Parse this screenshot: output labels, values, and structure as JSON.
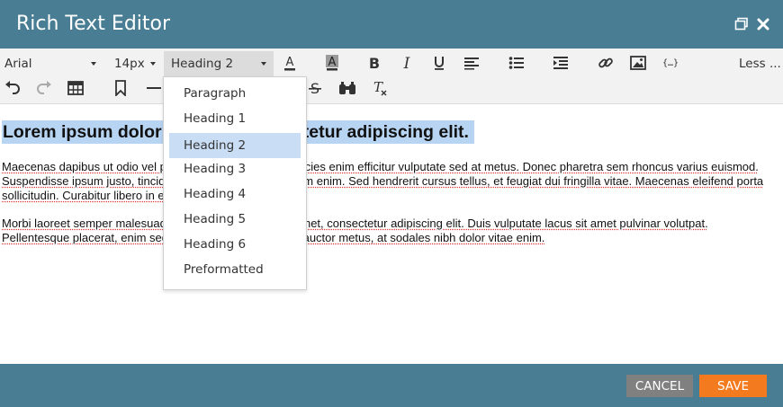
{
  "window": {
    "title": "Rich Text Editor",
    "restore_icon": "restore-window-icon",
    "close_icon": "close-icon"
  },
  "toolbar": {
    "font_family": "Arial",
    "font_size": "14px",
    "block_format": "Heading 2",
    "less_label": "Less ...",
    "row1_icons": [
      "font-color-icon",
      "background-color-icon",
      "bold-icon",
      "italic-icon",
      "underline-icon",
      "align-left-icon",
      "bulleted-list-icon",
      "indent-icon",
      "link-icon",
      "image-icon",
      "source-code-icon"
    ],
    "row2_icons": [
      "undo-icon",
      "redo-icon",
      "table-icon",
      "bookmark-icon",
      "horizontal-rule-icon",
      "strikethrough-icon",
      "find-replace-icon",
      "clear-formatting-icon"
    ]
  },
  "format_dropdown": {
    "items": [
      "Paragraph",
      "Heading 1",
      "Heading 2",
      "Heading 3",
      "Heading 4",
      "Heading 5",
      "Heading 6",
      "Preformatted"
    ],
    "selected": "Heading 2"
  },
  "content": {
    "heading": "Lorem ipsum dolor sit amet, consectetur adipiscing elit.",
    "paragraph_1": "Maecenas dapibus ut odio vel porttitor. Quisque luctus ultricies enim efficitur vulputate sed at metus. Donec pharetra sem rhoncus varius euismod. Suspendisse ipsum justo, tincidunt sit amet, molestie dictum enim. Sed hendrerit cursus tellus, et feugiat dui fringilla vitae. Maecenas eleifend porta sollicitudin. Curabitur libero in elementum.",
    "paragraph_2": "Morbi laoreet semper malesuada. Lorem ipsum dolor sit amet, consectetur adipiscing elit. Duis vulputate lacus sit amet pulvinar volutpat. Pellentesque placerat, enim sed feugiat tincidunt, felis dui auctor metus, at sodales nibh dolor vitae enim."
  },
  "footer": {
    "cancel_label": "CANCEL",
    "save_label": "SAVE"
  },
  "colors": {
    "header_bar": "#487d94",
    "save_button": "#f47a20",
    "cancel_button": "#808080",
    "selection": "#b7d4f2"
  }
}
